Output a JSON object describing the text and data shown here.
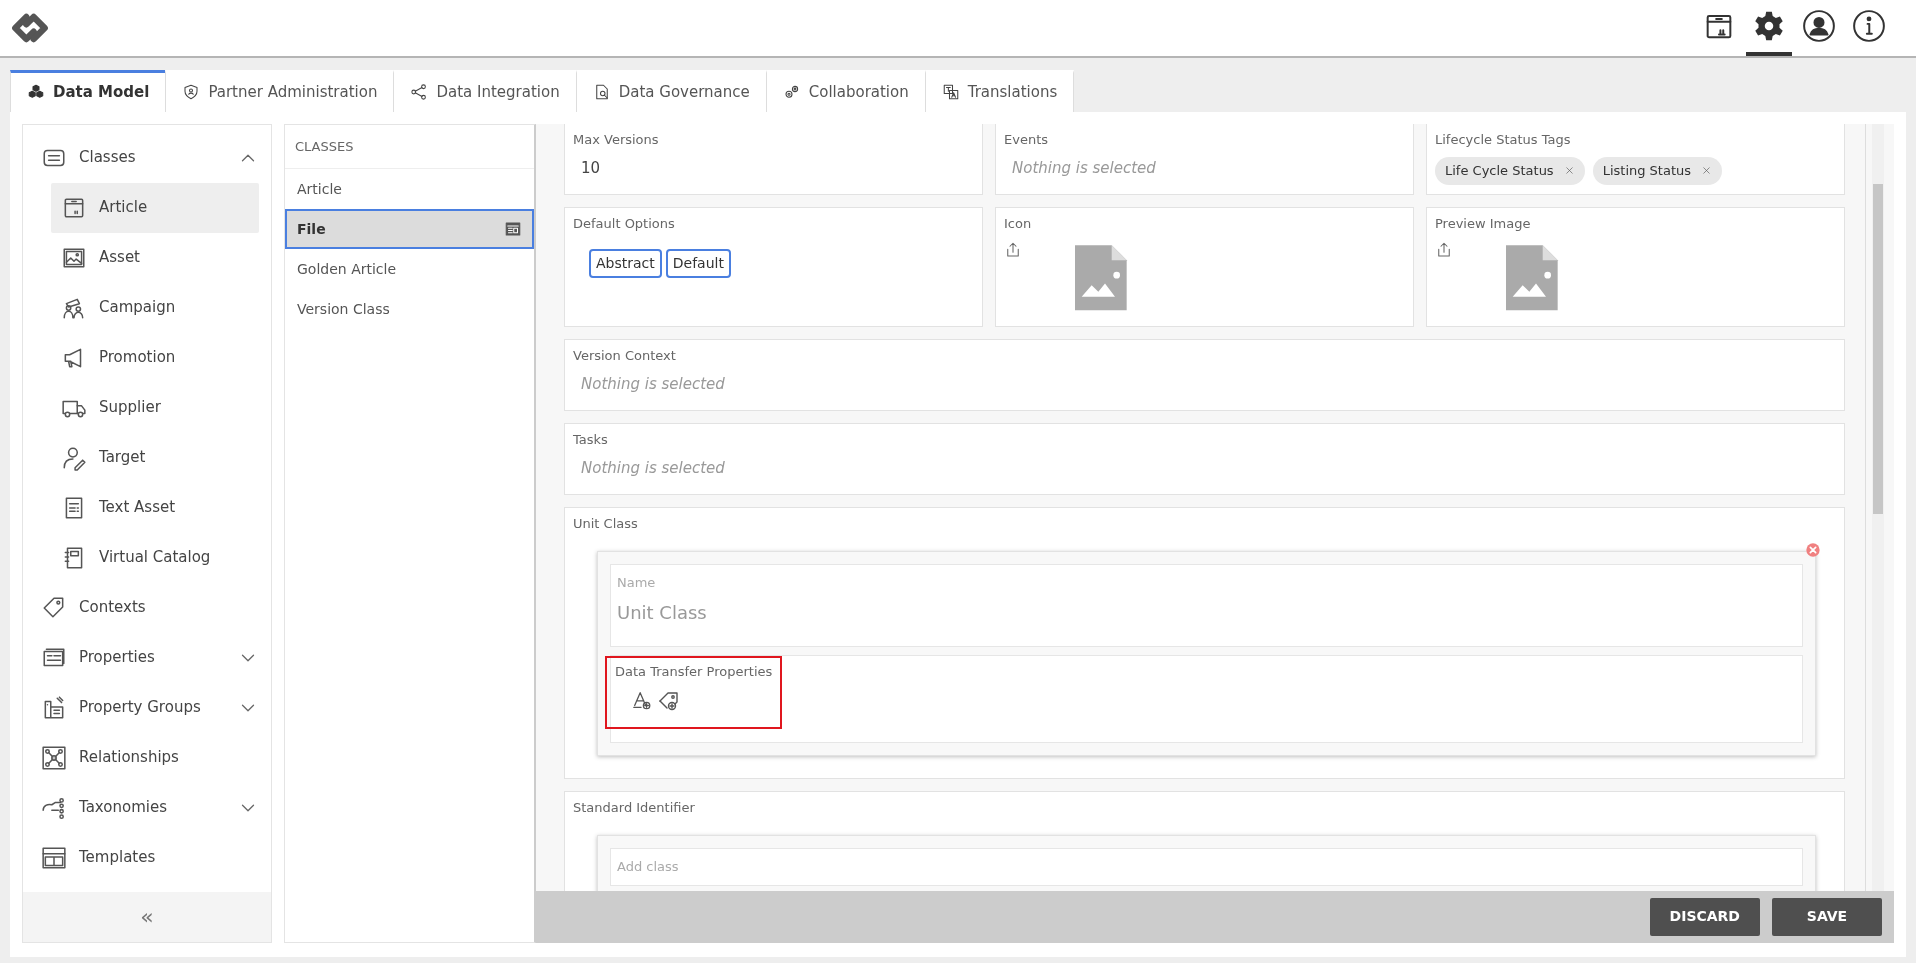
{
  "header": {
    "tools": [
      {
        "kind": "box",
        "selected": false
      },
      {
        "kind": "gear",
        "selected": true
      },
      {
        "kind": "user",
        "selected": false
      },
      {
        "kind": "info",
        "selected": false
      }
    ]
  },
  "tabs": [
    {
      "label": "Data Model",
      "selected": true
    },
    {
      "label": "Partner Administration",
      "selected": false
    },
    {
      "label": "Data Integration",
      "selected": false
    },
    {
      "label": "Data Governance",
      "selected": false
    },
    {
      "label": "Collaboration",
      "selected": false
    },
    {
      "label": "Translations",
      "selected": false
    }
  ],
  "sidebar": {
    "items": [
      {
        "label": "Classes",
        "selected": false,
        "expanded": true,
        "children": [
          {
            "label": "Article",
            "selected": true
          },
          {
            "label": "Asset",
            "selected": false
          },
          {
            "label": "Campaign",
            "selected": false
          },
          {
            "label": "Promotion",
            "selected": false
          },
          {
            "label": "Supplier",
            "selected": false
          },
          {
            "label": "Target",
            "selected": false
          },
          {
            "label": "Text Asset",
            "selected": false
          },
          {
            "label": "Virtual Catalog",
            "selected": false
          }
        ]
      },
      {
        "label": "Contexts",
        "selected": false
      },
      {
        "label": "Properties",
        "selected": false,
        "expanded": false
      },
      {
        "label": "Property Groups",
        "selected": false,
        "expanded": false
      },
      {
        "label": "Relationships",
        "selected": false
      },
      {
        "label": "Taxonomies",
        "selected": false,
        "expanded": false
      },
      {
        "label": "Templates",
        "selected": false
      }
    ],
    "collapse": "«"
  },
  "classes_list": {
    "heading": "CLASSES",
    "items": [
      {
        "label": "Article",
        "selected": false
      },
      {
        "label": "File",
        "selected": true
      },
      {
        "label": "Golden Article",
        "selected": false
      },
      {
        "label": "Version Class",
        "selected": false
      }
    ]
  },
  "field_rows": [
    {
      "fields": [
        {
          "kind": "text",
          "label": "Max Versions",
          "value": "10"
        },
        {
          "kind": "select",
          "label": "Events",
          "placeholder": "Nothing is selected"
        },
        {
          "kind": "tags",
          "label": "Lifecycle Status Tags",
          "tags": [
            "Life Cycle Status",
            "Listing Status"
          ]
        }
      ]
    },
    {
      "fields": [
        {
          "kind": "options",
          "label": "Default Options",
          "options": [
            {
              "label": "Abstract",
              "selected": true
            },
            {
              "label": "Default",
              "selected": true
            }
          ]
        },
        {
          "kind": "image",
          "label": "Icon"
        },
        {
          "kind": "image",
          "label": "Preview Image"
        }
      ]
    },
    {
      "fields": [
        {
          "kind": "select",
          "label": "Version Context",
          "placeholder": "Nothing is selected"
        }
      ]
    },
    {
      "fields": [
        {
          "kind": "select",
          "label": "Tasks",
          "placeholder": "Nothing is selected"
        }
      ]
    },
    {
      "fields": [
        {
          "kind": "class",
          "label": "Unit Class",
          "name_label": "Name",
          "name_value": "Unit Class",
          "dtp_label": "Data Transfer Properties",
          "highlighted": true
        }
      ]
    },
    {
      "fields": [
        {
          "kind": "class",
          "label": "Standard Identifier",
          "name_label": "Add class"
        }
      ]
    }
  ],
  "footer": {
    "buttons": [
      "DISCARD",
      "SAVE"
    ]
  }
}
